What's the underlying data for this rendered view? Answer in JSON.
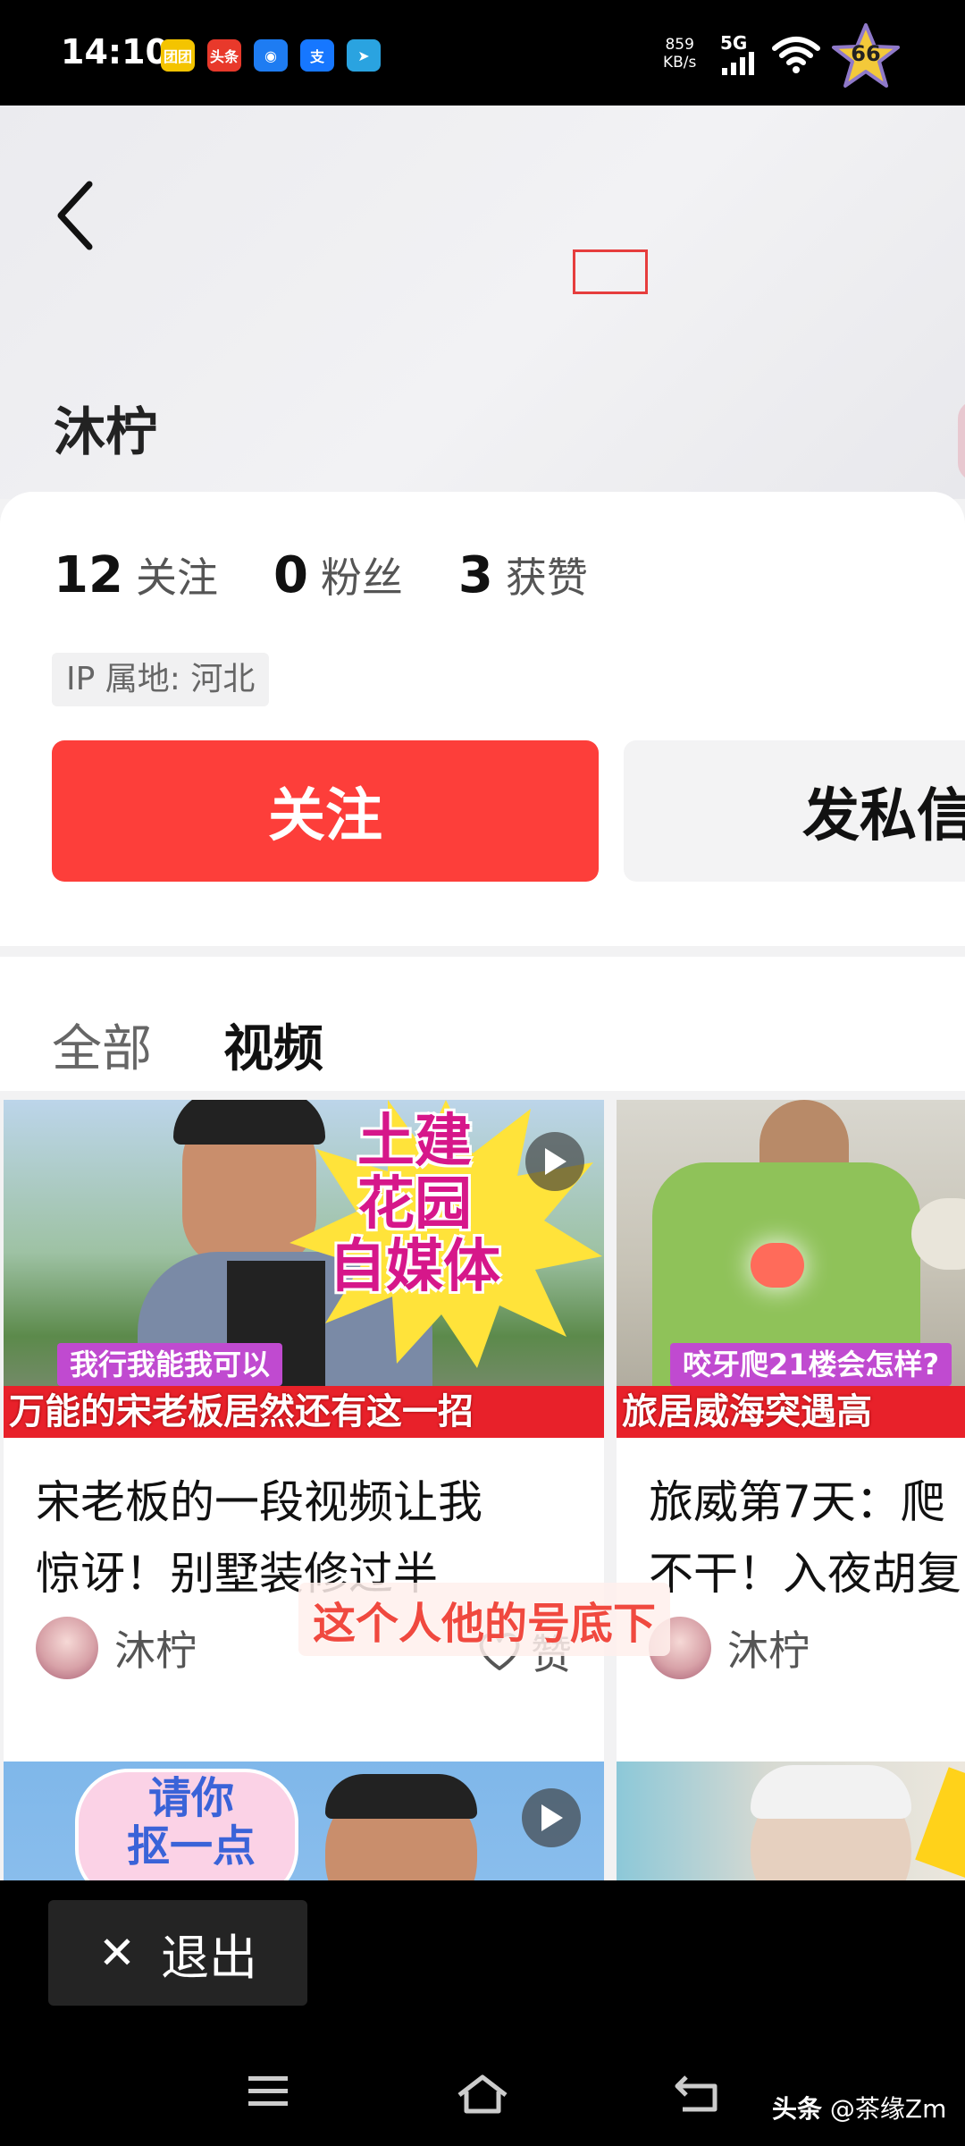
{
  "status_bar": {
    "time": "14:10",
    "app_icons": [
      {
        "name": "app-icon-1",
        "text": "团团",
        "color": "#f4c400"
      },
      {
        "name": "toutiao-icon",
        "text": "头条",
        "color": "#e8392b"
      },
      {
        "name": "app-icon-3",
        "text": "◉",
        "color": "#1e7cf2"
      },
      {
        "name": "alipay-icon",
        "text": "支",
        "color": "#1677ff"
      },
      {
        "name": "telegram-icon",
        "text": "➤",
        "color": "#2aa3e0"
      }
    ],
    "net_speed_value": "859",
    "net_speed_unit": "KB/s",
    "network_type": "5G",
    "badge_count": "66"
  },
  "profile": {
    "username": "沐柠",
    "stats": [
      {
        "num": "12",
        "label": "关注"
      },
      {
        "num": "0",
        "label": "粉丝"
      },
      {
        "num": "3",
        "label": "获赞"
      }
    ],
    "ip_location": "IP 属地: 河北",
    "follow_label": "关注",
    "message_label": "发私信"
  },
  "tabs": [
    {
      "label": "全部",
      "active": false
    },
    {
      "label": "视频",
      "active": true
    }
  ],
  "videos": [
    {
      "thumb_big_text": "土建\n花园\n自媒体",
      "thumb_tag": "我行我能我可以",
      "thumb_band": "万能的宋老板居然还有这一招",
      "title": "宋老板的一段视频让我\n惊讶！别墅装修过半",
      "author": "沐柠",
      "like_label": "赞"
    },
    {
      "thumb_tag": "咬牙爬21楼会怎样?",
      "thumb_band": "旅居威海突遇高",
      "title": "旅威第7天：爬\n不干！入夜胡复",
      "author": "沐柠"
    },
    {
      "thumb_big_text": "请你\n抠一点"
    },
    {}
  ],
  "subtitle_overlay": "这个人他的号底下",
  "exit_label": "退出",
  "watermark_prefix": "头条",
  "watermark_account": "@茶缘Zm",
  "colors": {
    "follow_button": "#fd3e3a",
    "band_red": "#e8212a"
  }
}
